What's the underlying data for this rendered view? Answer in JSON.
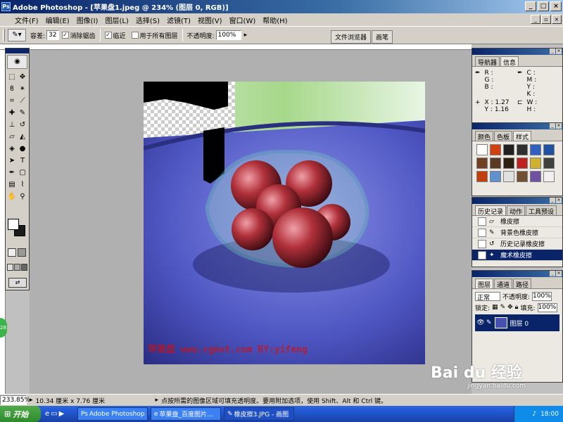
{
  "window": {
    "title": "Adobe Photoshop - [苹果盘1.jpeg @ 234% (图层 0, RGB)]",
    "app_icon": "Ps"
  },
  "menu": {
    "items": [
      "文件(F)",
      "编辑(E)",
      "图像(I)",
      "图层(L)",
      "选择(S)",
      "滤镜(T)",
      "视图(V)",
      "窗口(W)",
      "帮助(H)"
    ]
  },
  "options": {
    "tolerance_label": "容差:",
    "tolerance_value": "32",
    "antialias_label": "消除锯齿",
    "contiguous_label": "临近",
    "all_layers_label": "用于所有图层",
    "opacity_label": "不透明度:",
    "opacity_value": "100%",
    "file_browser_tab": "文件浏览器",
    "brushes_tab": "画笔"
  },
  "navigator_panel": {
    "tabs": [
      "导航器",
      "信息"
    ],
    "rgb_labels": [
      "R :",
      "G :",
      "B :"
    ],
    "cmyk_labels": [
      "C :",
      "M :",
      "Y :",
      "K :"
    ],
    "xy_labels": [
      "X :",
      "Y :"
    ],
    "x_value": "1.27",
    "y_value": "1.16",
    "wh_labels": [
      "W :",
      "H :"
    ]
  },
  "swatches_panel": {
    "tabs": [
      "颜色",
      "色板",
      "样式"
    ],
    "colors": [
      "#ffffff",
      "#d04010",
      "#202020",
      "#303030",
      "#3060c0",
      "#2050a0",
      "#704020",
      "#5a3a20",
      "#302010",
      "#c02020",
      "#d0b030",
      "#404040",
      "#c04010",
      "#6090d0",
      "#e0e0e0",
      "#705030",
      "#7050a0",
      "#f0f0f0"
    ]
  },
  "history_panel": {
    "tabs": [
      "历史记录",
      "动作",
      "工具预设"
    ],
    "items": [
      "橡皮擦",
      "背景色橡皮擦",
      "历史记录橡皮擦",
      "魔术橡皮擦"
    ]
  },
  "layers_panel": {
    "tabs": [
      "图层",
      "通道",
      "路径"
    ],
    "blend_mode": "正常",
    "opacity_label": "不透明度:",
    "opacity_value": "100%",
    "lock_label": "锁定:",
    "fill_label": "填充:",
    "fill_value": "100%",
    "layer_name": "图层 0"
  },
  "canvas": {
    "watermark_text": "苹果盘 www.cgmot.com BY:yifeng"
  },
  "status": {
    "zoom": "233.85%",
    "doc_size": "10.34 厘米 x 7.76 厘米",
    "hint": "点按所需的图像区域可填充透明度。要用附加选项，使用 Shift、Alt 和 Ctrl 键。"
  },
  "taskbar": {
    "start_label": "开始",
    "tasks": [
      "Adobe Photoshop ...",
      "苹果盘_百度图片...",
      "橡皮擦3.JPG - 画图"
    ],
    "time": "18:00"
  },
  "overlay": {
    "baidu_text": "Bai du 经验",
    "baidu_url": "jingyan.baidu.com"
  }
}
